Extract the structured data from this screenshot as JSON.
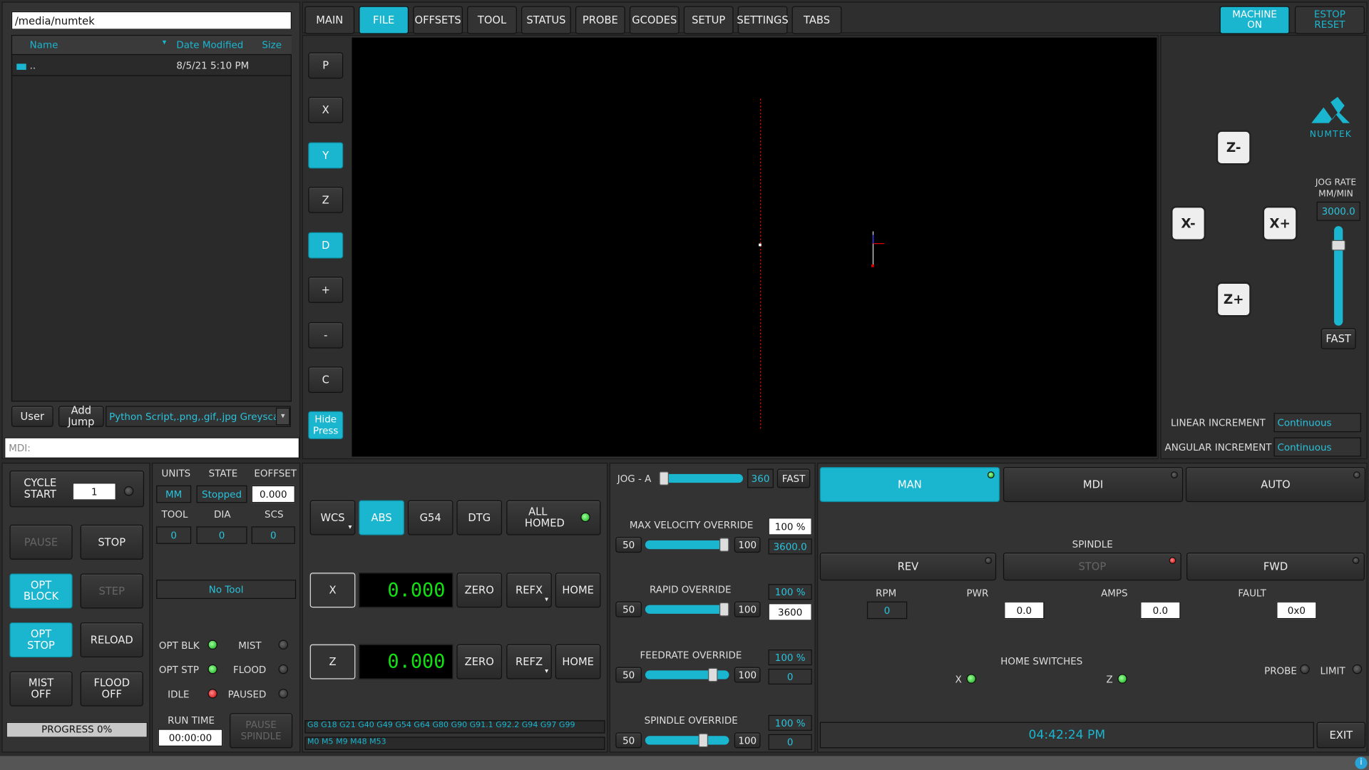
{
  "file_panel": {
    "path": "/media/numtek",
    "col_name": "Name",
    "col_date": "Date Modified",
    "col_size": "Size",
    "row_name": "..",
    "row_date": "8/5/21 5:10 PM",
    "user_label": "User",
    "add_jump_label": "Add Jump",
    "filter_text": "Python Script,.png,.gif,.jpg Greysca",
    "mdi_placeholder": "MDI:"
  },
  "tabs": [
    "MAIN",
    "FILE",
    "OFFSETS",
    "TOOL",
    "STATUS",
    "PROBE",
    "GCODES",
    "SETUP",
    "SETTINGS",
    "TABS"
  ],
  "top_right": {
    "machine_on": "MACHINE ON",
    "estop_reset": "ESTOP RESET"
  },
  "view_buttons": [
    "P",
    "X",
    "Y",
    "Z",
    "D",
    "+",
    "-",
    "C",
    "Hide Press"
  ],
  "jog": {
    "logo_text": "NUMTEK",
    "z_minus": "Z-",
    "x_minus": "X-",
    "x_plus": "X+",
    "z_plus": "Z+",
    "jog_rate_label": "JOG RATE MM/MIN",
    "jog_rate_value": "3000.0",
    "fast_label": "FAST",
    "linear_inc_label": "LINEAR INCREMENT",
    "linear_inc_value": "Continuous",
    "angular_inc_label": "ANGULAR INCREMENT",
    "angular_inc_value": "Continuous"
  },
  "cycle": {
    "cycle_start": "CYCLE START",
    "cycle_count": "1",
    "pause": "PAUSE",
    "stop": "STOP",
    "opt_block": "OPT BLOCK",
    "step": "STEP",
    "opt_stop": "OPT STOP",
    "reload": "RELOAD",
    "mist_off": "MIST OFF",
    "flood_off": "FLOOD OFF",
    "progress": "PROGRESS 0%",
    "progress_value": 0
  },
  "status": {
    "units_label": "UNITS",
    "state_label": "STATE",
    "eoffset_label": "EOFFSET",
    "units": "MM",
    "state": "Stopped",
    "eoffset": "0.000",
    "tool_label": "TOOL",
    "dia_label": "DIA",
    "scs_label": "SCS",
    "tool": "0",
    "dia": "0",
    "scs": "0",
    "no_tool": "No Tool",
    "opt_blk": "OPT BLK",
    "mist": "MIST",
    "opt_stp": "OPT STP",
    "flood": "FLOOD",
    "idle": "IDLE",
    "paused": "PAUSED",
    "run_time_label": "RUN TIME",
    "run_time": "00:00:00",
    "pause_spindle": "PAUSE SPINDLE"
  },
  "dro": {
    "wcs": "WCS",
    "abs": "ABS",
    "g54": "G54",
    "dtg": "DTG",
    "all_homed": "ALL HOMED",
    "x_label": "X",
    "x_value": "0.000",
    "z_label": "Z",
    "z_value": "0.000",
    "zero": "ZERO",
    "refx": "REFX",
    "refz": "REFZ",
    "home": "HOME",
    "gcodes_active": "G8 G18 G21 G40 G49 G54 G64 G80 G90 G91.1 G92.2 G94 G97 G99",
    "mcodes_active": "M0 M5 M9 M48 M53"
  },
  "overrides": {
    "jog_a_label": "JOG - A",
    "jog_a_value": "360",
    "jog_a_fast": "FAST",
    "max_vel_label": "MAX VELOCITY OVERRIDE",
    "max_vel_pct": "100 %",
    "max_vel_value": "3600.0",
    "rapid_label": "RAPID OVERRIDE",
    "rapid_pct": "100 %",
    "rapid_value": "3600",
    "feed_label": "FEEDRATE OVERRIDE",
    "feed_pct": "100 %",
    "feed_value": "0",
    "spindle_label": "SPINDLE OVERRIDE",
    "spindle_pct": "100 %",
    "spindle_value": "0",
    "min_value": "50",
    "max_value": "100"
  },
  "spindle": {
    "man": "MAN",
    "mdi": "MDI",
    "auto": "AUTO",
    "title": "SPINDLE",
    "rev": "REV",
    "stop": "STOP",
    "fwd": "FWD",
    "rpm_label": "RPM",
    "pwr_label": "PWR",
    "amps_label": "AMPS",
    "fault_label": "FAULT",
    "rpm": "0",
    "pwr": "0.0",
    "amps": "0.0",
    "fault": "0x0",
    "home_switches": "HOME SWITCHES",
    "x": "X",
    "z": "Z",
    "probe": "PROBE",
    "limit": "LIMIT",
    "clock": "04:42:24 PM",
    "exit": "EXIT"
  },
  "colors": {
    "accent": "#1ab6d0",
    "dro_text": "#12e012",
    "background": "#2b2b2b"
  }
}
